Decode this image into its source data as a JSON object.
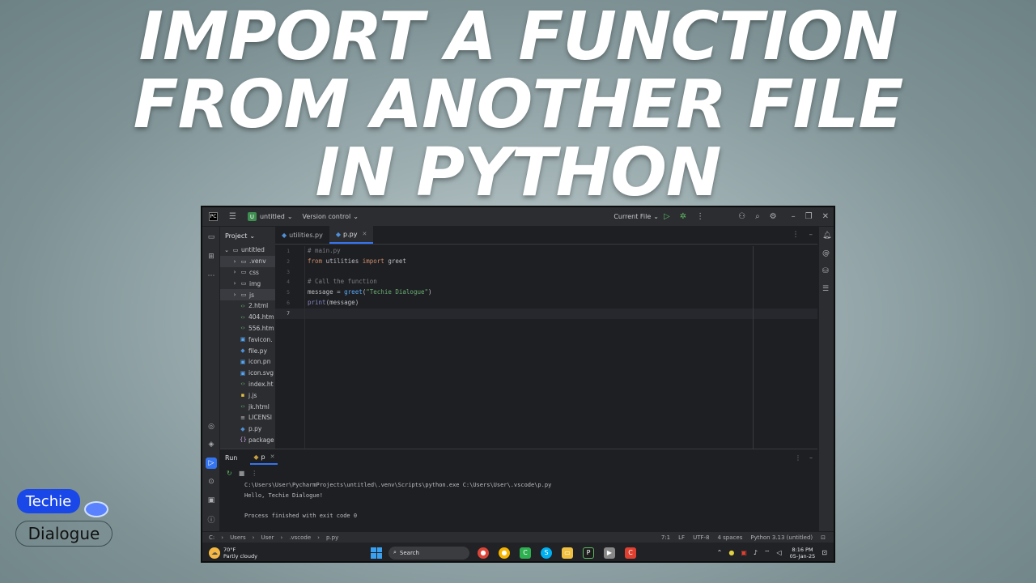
{
  "headline": {
    "line1": "IMPORT A FUNCTION",
    "line2": "FROM ANOTHER FILE",
    "line3": "IN PYTHON"
  },
  "titlebar": {
    "project_name": "untitled",
    "version_control": "Version control",
    "run_config": "Current File"
  },
  "project_panel": {
    "title": "Project",
    "items": [
      {
        "label": "untitled",
        "icon": "folder-icon"
      },
      {
        "label": ".venv",
        "icon": "folder-icon"
      },
      {
        "label": "css",
        "icon": "folder-icon"
      },
      {
        "label": "img",
        "icon": "folder-icon"
      },
      {
        "label": "js",
        "icon": "folder-icon"
      },
      {
        "label": "2.html",
        "icon": "html-icon"
      },
      {
        "label": "404.htm",
        "icon": "html-icon"
      },
      {
        "label": "556.htm",
        "icon": "html-icon"
      },
      {
        "label": "favicon.",
        "icon": "image-icon"
      },
      {
        "label": "file.py",
        "icon": "python-icon"
      },
      {
        "label": "icon.pn",
        "icon": "image-icon"
      },
      {
        "label": "icon.svg",
        "icon": "image-icon"
      },
      {
        "label": "index.ht",
        "icon": "html-icon"
      },
      {
        "label": "j.js",
        "icon": "js-icon"
      },
      {
        "label": "jk.html",
        "icon": "html-icon"
      },
      {
        "label": "LICENSI",
        "icon": "text-icon"
      },
      {
        "label": "p.py",
        "icon": "python-icon"
      },
      {
        "label": "package",
        "icon": "json-icon"
      }
    ]
  },
  "editor": {
    "tabs": [
      {
        "label": "utilities.py",
        "active": false
      },
      {
        "label": "p.py",
        "active": true
      }
    ],
    "line_numbers": [
      "1",
      "2",
      "3",
      "4",
      "5",
      "6",
      "7"
    ],
    "lines": {
      "l1": "# main.py",
      "l2_kw1": "from",
      "l2_mod": " utilities ",
      "l2_kw2": "import",
      "l2_name": " greet",
      "l4": "# Call the function",
      "l5_a": "message = ",
      "l5_fn": "greet",
      "l5_b": "(",
      "l5_str": "\"Techie Dialogue\"",
      "l5_c": ")",
      "l6_bi": "print",
      "l6_rest": "(message)"
    }
  },
  "run_panel": {
    "title": "Run",
    "tab": "p",
    "output": [
      "C:\\Users\\User\\PycharmProjects\\untitled\\.venv\\Scripts\\python.exe C:\\Users\\User\\.vscode\\p.py",
      "Hello, Techie Dialogue!",
      "",
      "Process finished with exit code 0"
    ]
  },
  "statusbar": {
    "crumbs": [
      "C:",
      "Users",
      "User",
      ".vscode",
      "p.py"
    ],
    "position": "7:1",
    "line_sep": "LF",
    "encoding": "UTF-8",
    "indent": "4 spaces",
    "interpreter": "Python 3.13 (untitled)"
  },
  "taskbar": {
    "temp": "70°F",
    "weather": "Partly cloudy",
    "search": "Search",
    "time": "8:16 PM",
    "date": "05-Jan-25"
  },
  "logo": {
    "top": "Techie",
    "bottom": "Dialogue"
  },
  "colors": {
    "accent": "#3574f0",
    "ide_bg": "#1e1f22",
    "panel_bg": "#2b2d30",
    "logo_blue": "#1a47e8"
  }
}
